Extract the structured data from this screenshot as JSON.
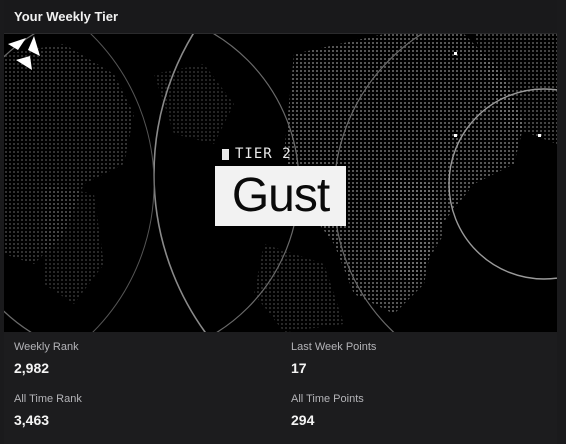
{
  "header": {
    "title": "Your Weekly Tier"
  },
  "tier": {
    "label": "TIER 2",
    "name": "Gust"
  },
  "icons": {
    "brand": "spinner-logo-icon",
    "tier_marker": "square-icon"
  },
  "colors": {
    "banner_bg": "#000000",
    "card_bg": "#1c1c1e",
    "tier_box": "#f2f2f2"
  },
  "stats": {
    "weekly_rank": {
      "label": "Weekly Rank",
      "value": "2,982"
    },
    "last_week_points": {
      "label": "Last Week Points",
      "value": "17"
    },
    "all_time_rank": {
      "label": "All Time Rank",
      "value": "3,463"
    },
    "all_time_points": {
      "label": "All Time Points",
      "value": "294"
    }
  }
}
